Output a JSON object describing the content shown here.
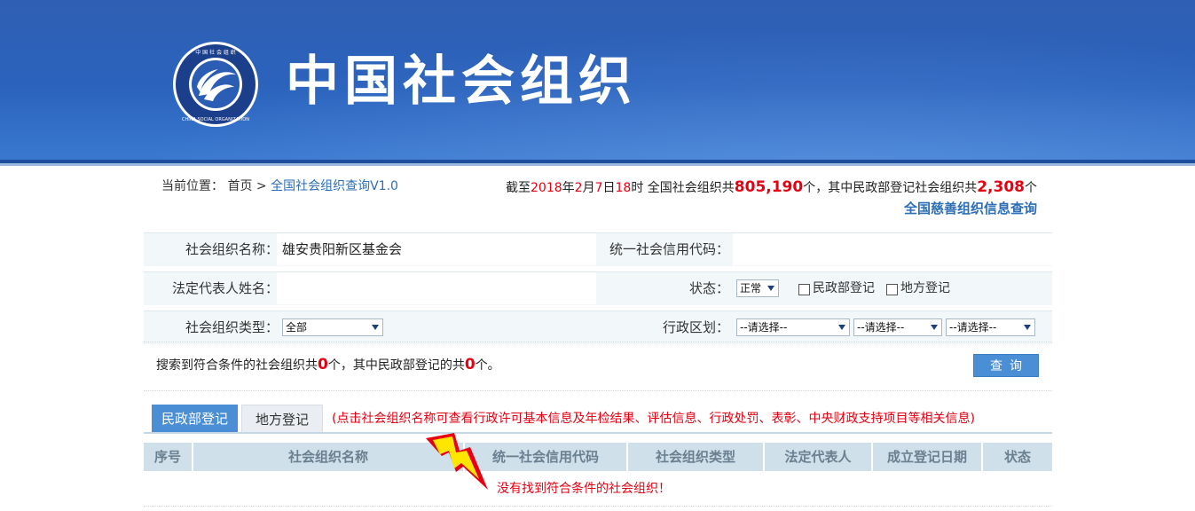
{
  "header": {
    "site_title": "中国社会组织",
    "logo_text": "中国社会组织 CHINA SOCIAL ORGANIZATION",
    "colors": {
      "banner": "#2b63bd",
      "accent": "#4a8fd6",
      "highlight": "#e60012"
    }
  },
  "breadcrumb": {
    "prefix": "当前位置：",
    "home": "首页",
    "separator": ">",
    "current": "全国社会组织查询V1.0"
  },
  "stats": {
    "p1": "截至",
    "year": "2018",
    "p2": "年",
    "month": "2",
    "p3": "月",
    "day": "7",
    "p4": "日",
    "hour": "18",
    "p5": "时 全国社会组织共",
    "total": "805,190",
    "p6": "个，其中民政部登记社会组织共",
    "ministry_count": "2,308",
    "p7": "个",
    "charity_link": "全国慈善组织信息查询"
  },
  "form": {
    "org_name_label": "社会组织名称：",
    "org_name_value": "雄安贵阳新区基金会",
    "credit_code_label": "统一社会信用代码：",
    "credit_code_value": "",
    "legal_rep_label": "法定代表人姓名：",
    "legal_rep_value": "",
    "status_label": "状态：",
    "status_value": "正常",
    "checkbox_ministry": "民政部登记",
    "checkbox_local": "地方登记",
    "org_type_label": "社会组织类型：",
    "org_type_value": "全部",
    "region_label": "行政区划：",
    "region_select_1": "--请选择--",
    "region_select_2": "--请选择--",
    "region_select_3": "--请选择--"
  },
  "result": {
    "p1": "搜索到符合条件的社会组织共",
    "total": "0",
    "p2": "个，其中民政部登记的共",
    "ministry": "0",
    "p3": "个。",
    "query_button": "查询"
  },
  "tabs": {
    "active": "民政部登记",
    "inactive": "地方登记",
    "note": "(点击社会组织名称可查看行政许可基本信息及年检结果、评估信息、行政处罚、表彰、中央财政支持项目等相关信息)"
  },
  "table": {
    "columns": [
      "序号",
      "社会组织名称",
      "统一社会信用代码",
      "社会组织类型",
      "法定代表人",
      "成立登记日期",
      "状态"
    ],
    "empty_message": "没有找到符合条件的社会组织！"
  }
}
